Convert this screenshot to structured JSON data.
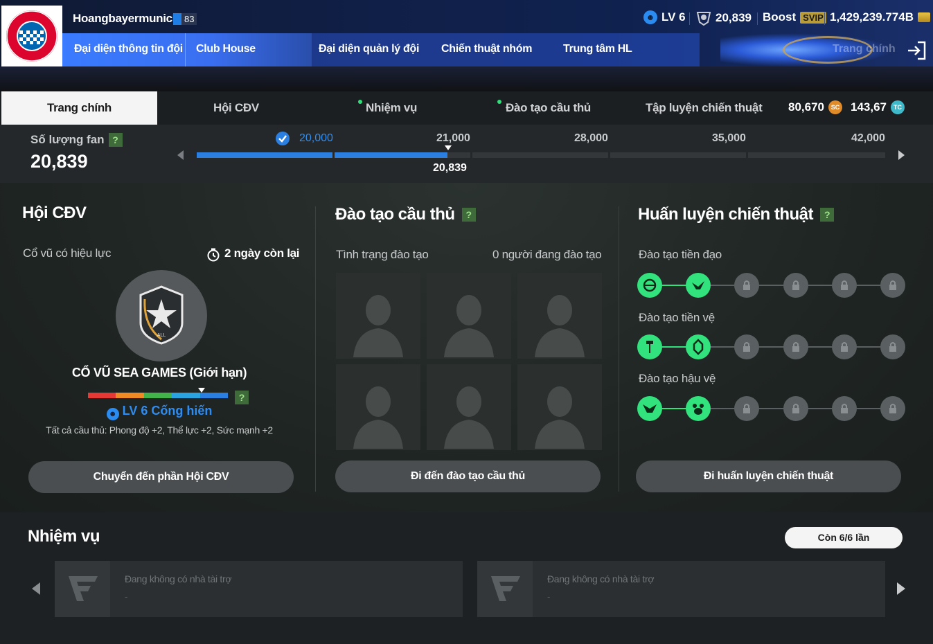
{
  "header": {
    "username": "Hoangbayermunich",
    "ovr": "83",
    "level": "LV 6",
    "vip_points": "20,839",
    "boost_label": "Boost",
    "svip_label": "SVIP",
    "bp": "1,429,239.774B",
    "nav": [
      {
        "label": "Đại diện thông tin đội"
      },
      {
        "label": "Club House"
      },
      {
        "label": "Đại diện quản lý đội"
      },
      {
        "label": "Chiến thuật nhóm"
      },
      {
        "label": "Trung tâm HL"
      }
    ],
    "nav_ghost": "Trang chính",
    "colors": {
      "accent_blue": "#3a7bff",
      "green": "#31e27d"
    }
  },
  "tabs": [
    {
      "label": "Trang chính",
      "active": true
    },
    {
      "label": "Hội CĐV"
    },
    {
      "label": "Nhiệm vụ",
      "dot": true
    },
    {
      "label": "Đào tạo cầu thủ",
      "dot": true
    },
    {
      "label": "Tập luyện chiến thuật"
    }
  ],
  "currency": {
    "sc": "80,670",
    "sc_icon": "SC",
    "tc": "143,67",
    "tc_icon": "TC"
  },
  "fans": {
    "label": "Số lượng fan",
    "help": "?",
    "count": "20,839",
    "milestones": [
      "20,000",
      "21,000",
      "28,000",
      "35,000",
      "42,000"
    ],
    "current_marker": "20,839",
    "progress": 0.3644
  },
  "supporters": {
    "title": "Hội CĐV",
    "effect_label": "Cổ vũ có hiệu lực",
    "time_left": "2 ngày còn lại",
    "badge_text": "ALL",
    "badge_name": "CỔ VŨ SEA GAMES (Giới hạn)",
    "level_text": "LV 6 Cống hiến",
    "effect_desc": "Tất cả cầu thủ: Phong độ +2, Thể lực +2, Sức mạnh +2",
    "help": "?",
    "button": "Chuyển đến phần Hội CĐV"
  },
  "training": {
    "title": "Đào tạo cầu thủ",
    "help": "?",
    "status_label": "Tình trạng đào tạo",
    "status_value": "0 người đang đào tạo",
    "button": "Đi đến đào tạo cầu thủ"
  },
  "tactics": {
    "title": "Huấn luyện chiến thuật",
    "help": "?",
    "rows": [
      {
        "label": "Đào tạo tiền đạo",
        "unlocked": 2,
        "total": 6
      },
      {
        "label": "Đào tạo tiền vệ",
        "unlocked": 2,
        "total": 6
      },
      {
        "label": "Đào tạo hậu vệ",
        "unlocked": 2,
        "total": 6
      }
    ],
    "button": "Đi huấn luyện chiến thuật"
  },
  "missions": {
    "title": "Nhiệm vụ",
    "remaining": "Còn 6/6 lần",
    "cards": [
      {
        "text": "Đang không có nhà tài trợ",
        "sub": "-"
      },
      {
        "text": "Đang không có nhà tài trợ",
        "sub": "-"
      }
    ]
  }
}
